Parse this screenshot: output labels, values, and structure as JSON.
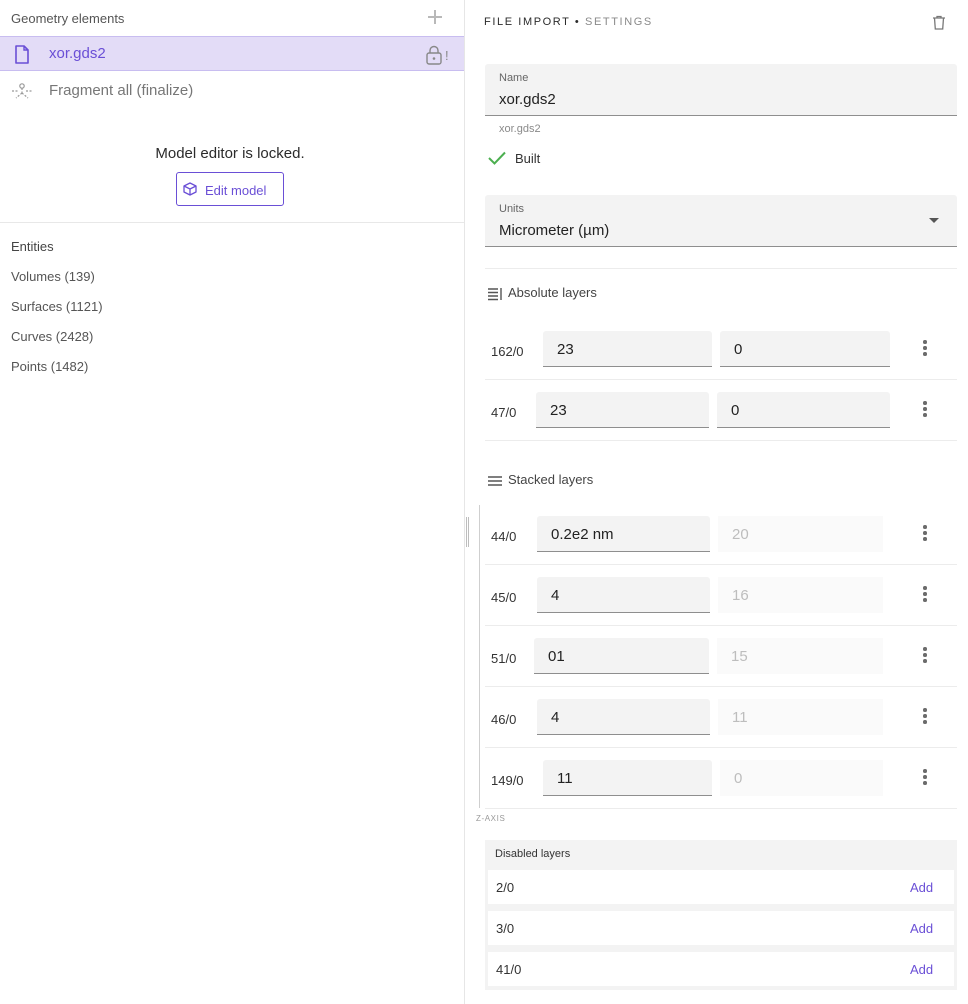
{
  "left_panel": {
    "header_title": "Geometry elements",
    "file_item": {
      "name": "xor.gds2",
      "lock_badge": "!"
    },
    "fragment_item": "Fragment all (finalize)",
    "locked_message": "Model editor is locked.",
    "edit_button": "Edit model",
    "entities_title": "Entities",
    "entities": [
      "Volumes (139)",
      "Surfaces (1121)",
      "Curves (2428)",
      "Points (1482)"
    ]
  },
  "right_panel": {
    "title": "FILE IMPORT",
    "title_sep": "•",
    "subtitle": "SETTINGS",
    "name_field": {
      "label": "Name",
      "value": "xor.gds2",
      "hint": "xor.gds2"
    },
    "status": "Built",
    "units_field": {
      "label": "Units",
      "value": "Micrometer (µm)"
    },
    "absolute_layers": {
      "title": "Absolute layers",
      "rows": [
        {
          "id": "162/0",
          "thickness": "23",
          "z": "0"
        },
        {
          "id": "47/0",
          "thickness": "23",
          "z": "0"
        }
      ]
    },
    "stacked_layers": {
      "title": "Stacked layers",
      "rows": [
        {
          "id": "44/0",
          "thickness": "0.2e2  nm",
          "z": "20"
        },
        {
          "id": "45/0",
          "thickness": "4",
          "z": "16"
        },
        {
          "id": "51/0",
          "thickness": "01",
          "z": "15"
        },
        {
          "id": "46/0",
          "thickness": "4",
          "z": "11"
        },
        {
          "id": "149/0",
          "thickness": "11",
          "z": "0"
        }
      ],
      "axis_label": "Z-AXIS"
    },
    "disabled_layers": {
      "title": "Disabled layers",
      "add_label": "Add",
      "rows": [
        "2/0",
        "3/0",
        "41/0"
      ]
    }
  },
  "colors": {
    "accent": "#6a4fd6",
    "selected_bg": "#e3dcf7",
    "check": "#4caf50"
  },
  "icons": [
    "plus-icon",
    "file-icon",
    "lock-icon",
    "fragment-icon",
    "cube-icon",
    "trash-icon",
    "check-icon",
    "dropdown-arrow-icon",
    "absolute-layers-icon",
    "stacked-layers-icon",
    "more-vert-icon"
  ]
}
